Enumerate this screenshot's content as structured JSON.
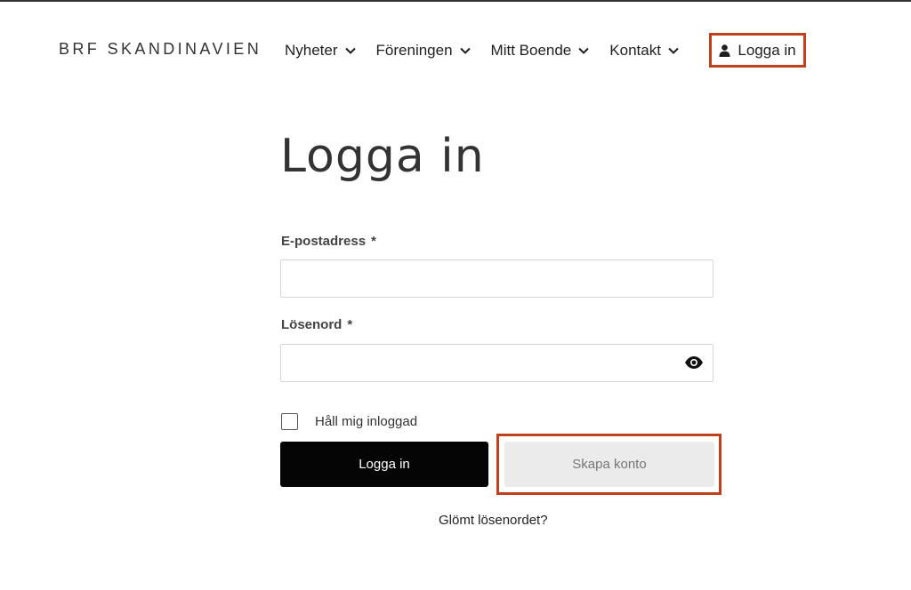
{
  "header": {
    "brand": "BRF SKANDINAVIEN",
    "nav": [
      {
        "label": "Nyheter"
      },
      {
        "label": "Föreningen"
      },
      {
        "label": "Mitt Boende"
      },
      {
        "label": "Kontakt"
      }
    ],
    "login_label": "Logga in"
  },
  "main": {
    "title": "Logga in",
    "email_label": "E-postadress",
    "password_label": "Lösenord",
    "required_mark": "*",
    "email_value": "",
    "password_value": "",
    "remember_label": "Håll mig inloggad",
    "remember_checked": false,
    "login_button": "Logga in",
    "create_button": "Skapa konto",
    "forgot_link": "Glömt lösenordet?"
  },
  "icons": {
    "nav_chevron": "chevron-down-icon",
    "login": "user-icon",
    "password_toggle": "eye-icon"
  },
  "colors": {
    "highlight": "#c0401b",
    "primary_button": "#050505",
    "secondary_button": "#ebebeb"
  }
}
